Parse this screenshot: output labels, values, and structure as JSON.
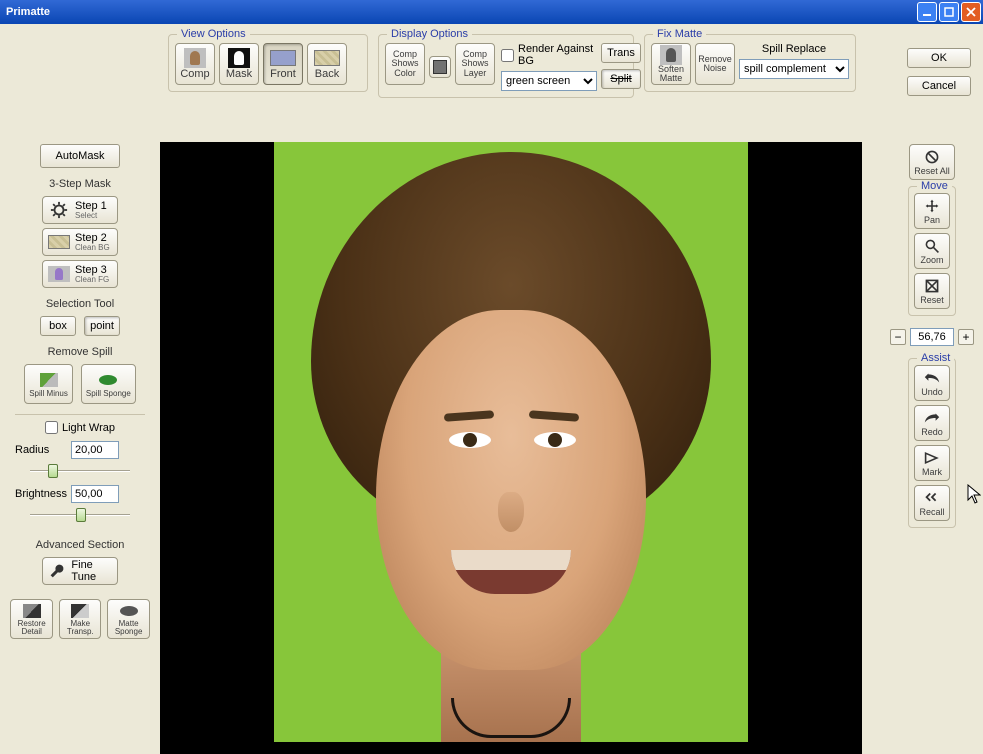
{
  "window": {
    "title": "Primatte"
  },
  "ok": "OK",
  "cancel": "Cancel",
  "viewOptions": {
    "legend": "View Options",
    "comp": "Comp",
    "mask": "Mask",
    "front": "Front",
    "back": "Back"
  },
  "displayOptions": {
    "legend": "Display Options",
    "compShowsColor": "Comp Shows Color",
    "compShowsLayer": "Comp Shows Layer",
    "renderAgainstBG": "Render Against BG",
    "bgSelect": "green screen",
    "trans": "Trans",
    "split": "Split"
  },
  "fixMatte": {
    "legend": "Fix Matte",
    "softenMatte": "Soften Matte",
    "removeNoise": "Remove Noise",
    "spillReplaceLabel": "Spill Replace",
    "spillReplaceSelect": "spill complement"
  },
  "left": {
    "autoMask": "AutoMask",
    "threeStep": "3-Step Mask",
    "step1": {
      "t": "Step 1",
      "s": "Select"
    },
    "step2": {
      "t": "Step 2",
      "s": "Clean BG"
    },
    "step3": {
      "t": "Step 3",
      "s": "Clean FG"
    },
    "selectionTool": "Selection Tool",
    "box": "box",
    "point": "point",
    "removeSpill": "Remove Spill",
    "spillMinus": "Spill Minus",
    "spillSponge": "Spill Sponge",
    "lightWrap": "Light Wrap",
    "radius": "Radius",
    "radiusVal": "20,00",
    "brightness": "Brightness",
    "brightnessVal": "50,00",
    "advanced": "Advanced Section",
    "fineTune": "Fine Tune",
    "restoreDetail": "Restore Detail",
    "makeTransp": "Make Transp.",
    "matteSponge": "Matte Sponge"
  },
  "right": {
    "resetAll": "Reset All",
    "move": "Move",
    "pan": "Pan",
    "zoom": "Zoom",
    "reset": "Reset",
    "zoomVal": "56,76",
    "assist": "Assist",
    "undo": "Undo",
    "redo": "Redo",
    "mark": "Mark",
    "recall": "Recall"
  }
}
